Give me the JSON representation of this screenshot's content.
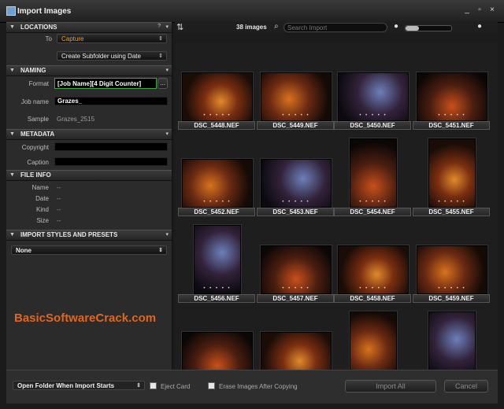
{
  "window": {
    "title": "Import Images",
    "controls": [
      "_",
      "▫",
      "×"
    ]
  },
  "sections": {
    "locations": "LOCATIONS",
    "naming": "NAMING",
    "metadata": "METADATA",
    "file_info": "FILE INFO",
    "import_styles": "IMPORT STYLES AND PRESETS"
  },
  "locations": {
    "to_label": "To",
    "to_value": "Capture",
    "subfolder_value": "Create Subfolder using Date"
  },
  "naming": {
    "format_label": "Format",
    "format_value": "[Job Name][4 Digit Counter]",
    "format_button": "...",
    "jobname_label": "Job name",
    "jobname_value": "Grazes_",
    "sample_label": "Sample",
    "sample_value": "Grazes_2515"
  },
  "metadata": {
    "copyright_label": "Copyright",
    "copyright_value": "",
    "caption_label": "Caption",
    "caption_value": ""
  },
  "file_info": {
    "name_label": "Name",
    "name_value": "--",
    "date_label": "Date",
    "date_value": "--",
    "kind_label": "Kind",
    "kind_value": "--",
    "size_label": "Size",
    "size_value": "--"
  },
  "import_styles": {
    "value": "None"
  },
  "toolbar": {
    "count": "38 images",
    "search_placeholder": "Search Import",
    "slider_level": 0.3
  },
  "photos": {
    "dots": "• • • • •",
    "rows": [
      [
        "DSC_5448.NEF",
        "DSC_5449.NEF",
        "DSC_5450.NEF",
        "DSC_5451.NEF"
      ],
      [
        "DSC_5452.NEF",
        "DSC_5453.NEF",
        "DSC_5454.NEF",
        "DSC_5455.NEF"
      ],
      [
        "DSC_5456.NEF",
        "DSC_5457.NEF",
        "DSC_5458.NEF",
        "DSC_5459.NEF"
      ],
      [
        "",
        "",
        "",
        ""
      ]
    ]
  },
  "bottom": {
    "open_folder": "Open Folder When Import Starts",
    "eject_card": "Eject Card",
    "erase_images": "Erase Images After Copying",
    "import_all": "Import All",
    "cancel": "Cancel"
  },
  "watermark": "BasicSoftwareCrack.com",
  "colors": {
    "accent": "#e0661b",
    "capture": "#f0a020",
    "format_border": "#3ea83e"
  }
}
